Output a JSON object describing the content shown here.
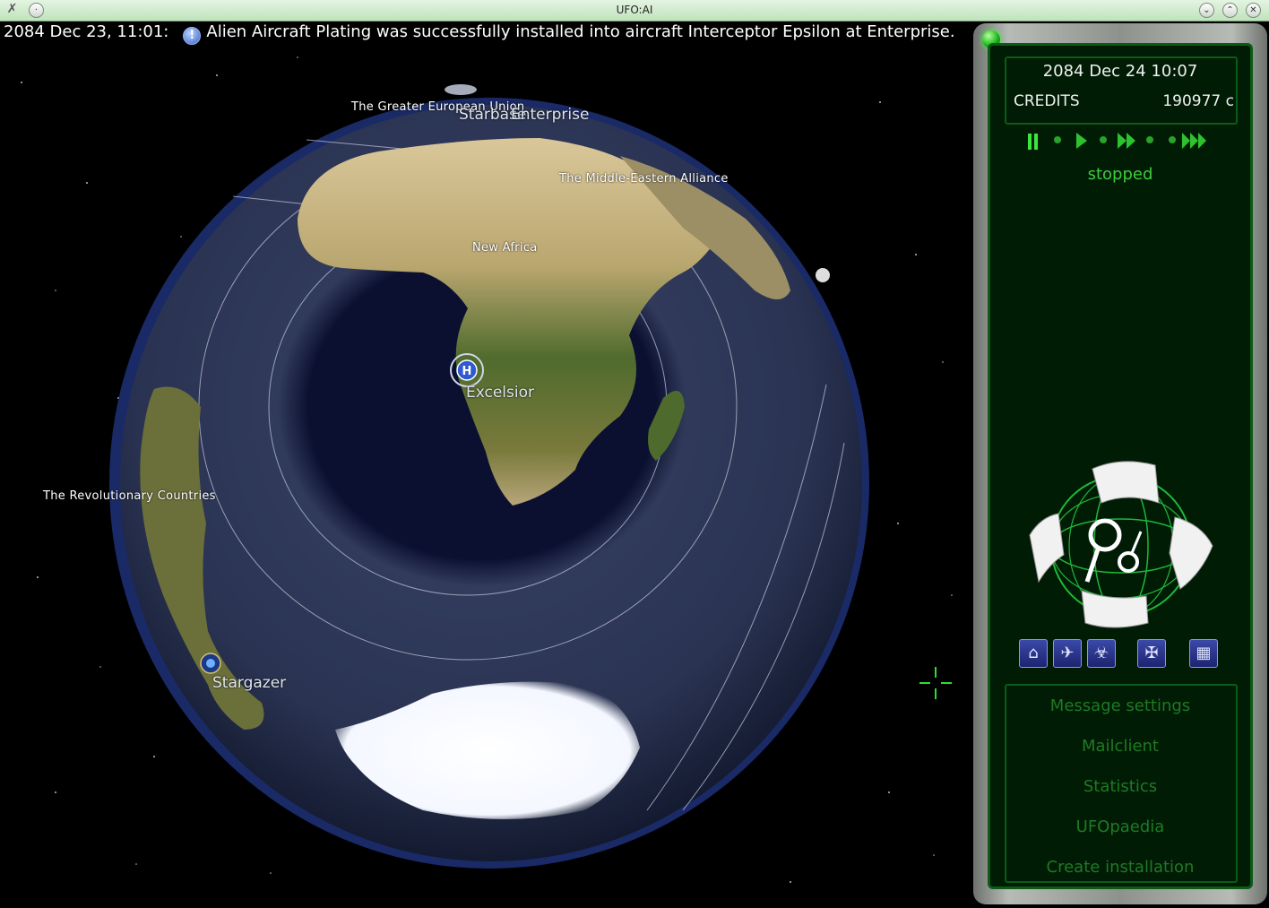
{
  "window": {
    "title": "UFO:AI"
  },
  "message": {
    "timestamp": "2084 Dec 23, 11:01:",
    "icon": "!",
    "text": "Alien Aircraft Plating was successfully installed into aircraft Interceptor Epsilon at Enterprise."
  },
  "map": {
    "regions": {
      "europe": "The Greater European Union",
      "middle_east": "The Middle-Eastern Alliance",
      "africa": "New Africa",
      "americas": "The Revolutionary Countries"
    },
    "bases": {
      "starbase": "Starbase",
      "enterprise": "Enterprise",
      "excelsior": "Excelsior",
      "stargazer": "Stargazer"
    }
  },
  "panel": {
    "date": "2084 Dec 24 10:07",
    "credits_label": "CREDITS",
    "credits_value": "190977 c",
    "time_status": "stopped",
    "menu": {
      "message_settings": "Message settings",
      "mailclient": "Mailclient",
      "statistics": "Statistics",
      "ufopaedia": "UFOpaedia",
      "create_installation": "Create installation"
    }
  },
  "colors": {
    "panel_green": "#001c05",
    "border_green": "#0c5a16",
    "active_green": "#3ccc3c",
    "menu_green": "#1f7a24"
  }
}
